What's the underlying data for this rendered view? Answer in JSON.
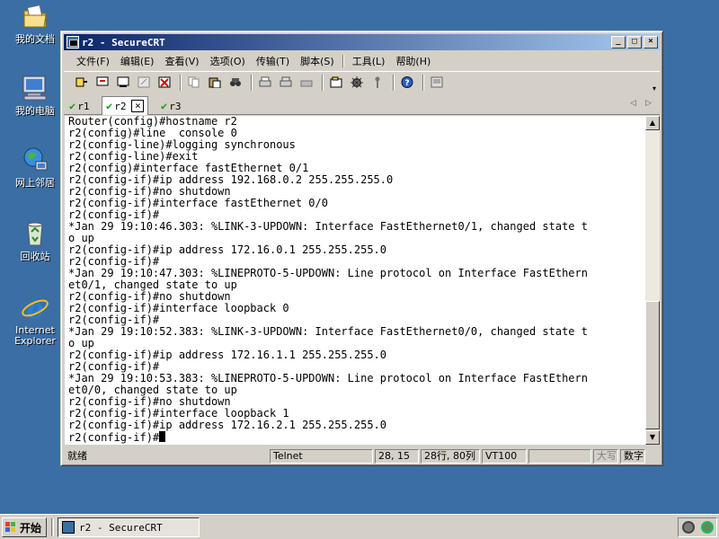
{
  "desktop": {
    "icons": [
      {
        "label": "我的文档",
        "icon": "my-documents-icon"
      },
      {
        "label": "我的电脑",
        "icon": "my-computer-icon"
      },
      {
        "label": "网上邻居",
        "icon": "network-icon"
      },
      {
        "label": "回收站",
        "icon": "recycle-bin-icon"
      },
      {
        "label": "Internet Explorer",
        "icon": "internet-explorer-icon"
      }
    ]
  },
  "window": {
    "title": "r2 - SecureCRT",
    "minimize": "_",
    "maximize": "□",
    "close": "×"
  },
  "menu": [
    "文件(F)",
    "编辑(E)",
    "查看(V)",
    "选项(O)",
    "传输(T)",
    "脚本(S)",
    "工具(L)",
    "帮助(H)"
  ],
  "tabs": [
    {
      "label": "r1",
      "active": false
    },
    {
      "label": "r2",
      "active": true
    },
    {
      "label": "r3",
      "active": false
    }
  ],
  "tab_close": "×",
  "tab_nav": {
    "prev": "◁",
    "next": "▷"
  },
  "terminal": {
    "lines": [
      "Router(config)#hostname r2",
      "r2(config)#line  console 0",
      "r2(config-line)#logging synchronous",
      "r2(config-line)#exit",
      "r2(config)#interface fastEthernet 0/1",
      "r2(config-if)#ip address 192.168.0.2 255.255.255.0",
      "r2(config-if)#no shutdown",
      "r2(config-if)#interface fastEthernet 0/0",
      "r2(config-if)#",
      "*Jan 29 19:10:46.303: %LINK-3-UPDOWN: Interface FastEthernet0/1, changed state t",
      "o up",
      "r2(config-if)#ip address 172.16.0.1 255.255.255.0",
      "r2(config-if)#",
      "*Jan 29 19:10:47.303: %LINEPROTO-5-UPDOWN: Line protocol on Interface FastEthern",
      "et0/1, changed state to up",
      "r2(config-if)#no shutdown",
      "r2(config-if)#interface loopback 0",
      "r2(config-if)#",
      "*Jan 29 19:10:52.383: %LINK-3-UPDOWN: Interface FastEthernet0/0, changed state t",
      "o up",
      "r2(config-if)#ip address 172.16.1.1 255.255.255.0",
      "r2(config-if)#",
      "*Jan 29 19:10:53.383: %LINEPROTO-5-UPDOWN: Line protocol on Interface FastEthern",
      "et0/0, changed state to up",
      "r2(config-if)#no shutdown",
      "r2(config-if)#interface loopback 1",
      "r2(config-if)#ip address 172.16.2.1 255.255.255.0"
    ],
    "prompt": "r2(config-if)#"
  },
  "status": {
    "ready": "就绪",
    "protocol": "Telnet",
    "cursor_pos": "28, 15",
    "dimensions": "28行, 80列",
    "emulation": "VT100",
    "blank": "",
    "caps": "大写",
    "num": "数字"
  },
  "taskbar": {
    "start": "开始",
    "task": "r2 - SecureCRT"
  },
  "colors": {
    "desktop": "#3a6ea5",
    "title_active": "#0a246a",
    "tab_check": "#1a9a1a"
  }
}
